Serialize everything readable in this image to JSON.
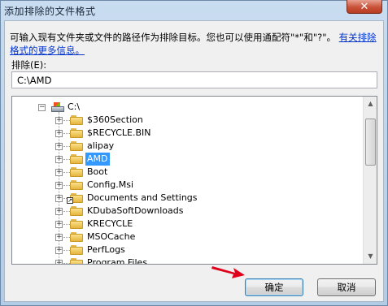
{
  "window": {
    "title": "添加排除的文件格式",
    "close_glyph": "✕"
  },
  "description": {
    "text": "可输入现有文件夹或文件的路径作为排除目标。您也可以使用通配符\"*\"和\"?\"。",
    "link": "有关排除格式的更多信息。"
  },
  "exclude": {
    "label": "排除(E):",
    "value": "C:\\AMD"
  },
  "tree": {
    "root": "C:\\",
    "items": [
      {
        "label": "$360Section",
        "selected": false,
        "shortcut": false
      },
      {
        "label": "$RECYCLE.BIN",
        "selected": false,
        "shortcut": false
      },
      {
        "label": "alipay",
        "selected": false,
        "shortcut": false
      },
      {
        "label": "AMD",
        "selected": true,
        "shortcut": false
      },
      {
        "label": "Boot",
        "selected": false,
        "shortcut": false
      },
      {
        "label": "Config.Msi",
        "selected": false,
        "shortcut": false
      },
      {
        "label": "Documents and Settings",
        "selected": false,
        "shortcut": true
      },
      {
        "label": "KDubaSoftDownloads",
        "selected": false,
        "shortcut": false
      },
      {
        "label": "KRECYCLE",
        "selected": false,
        "shortcut": false
      },
      {
        "label": "MSOCache",
        "selected": false,
        "shortcut": false
      },
      {
        "label": "PerfLogs",
        "selected": false,
        "shortcut": false
      },
      {
        "label": "Program Files",
        "selected": false,
        "shortcut": false
      }
    ]
  },
  "buttons": {
    "ok": "确定",
    "cancel": "取消"
  },
  "colors": {
    "selection": "#3399ff",
    "annotation_arrow": "#e0001a",
    "link": "#0033cc"
  }
}
